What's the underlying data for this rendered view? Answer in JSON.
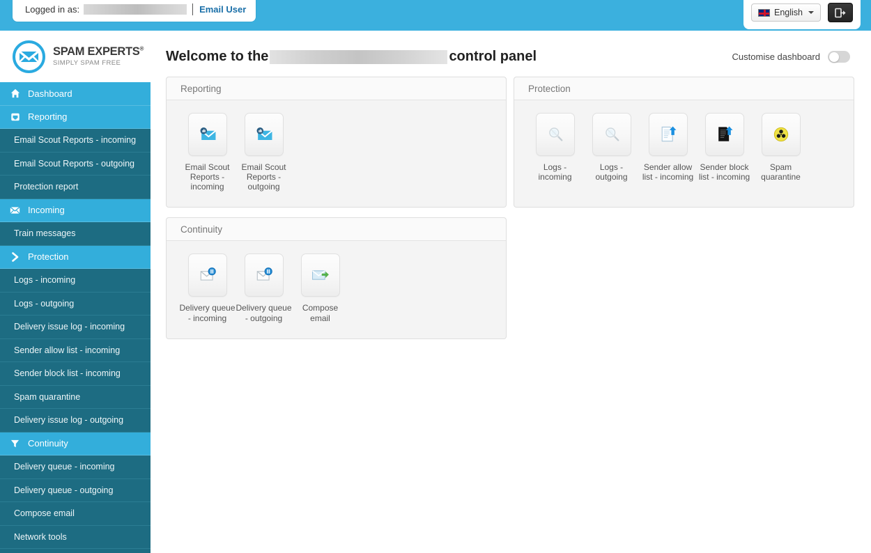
{
  "topbar": {
    "logged_in_label": "Logged in as:",
    "logged_in_user_redacted": "",
    "email_user_link": "Email User",
    "language": "English",
    "language_flag_icon": "uk-flag-icon",
    "logout_icon": "logout-icon"
  },
  "brand": {
    "name_main": "SPAM EXPERTS",
    "registered_mark": "®",
    "tagline": "SIMPLY SPAM FREE",
    "logo_icon": "envelope-circle-logo-icon",
    "accent_color": "#3bb0de"
  },
  "sidebar": {
    "bg_color": "#1d6c82",
    "header_color": "#33aedb",
    "items": [
      {
        "label": "Dashboard",
        "type": "head",
        "icon": "home-icon"
      },
      {
        "label": "Reporting",
        "type": "head",
        "icon": "inbox-tray-icon"
      },
      {
        "label": "Email Scout Reports - incoming",
        "type": "sub"
      },
      {
        "label": "Email Scout Reports - outgoing",
        "type": "sub"
      },
      {
        "label": "Protection report",
        "type": "sub"
      },
      {
        "label": "Incoming",
        "type": "head",
        "icon": "envelope-icon"
      },
      {
        "label": "Train messages",
        "type": "sub"
      },
      {
        "label": "Protection",
        "type": "head",
        "icon": "chevron-right-icon"
      },
      {
        "label": "Logs - incoming",
        "type": "sub"
      },
      {
        "label": "Logs - outgoing",
        "type": "sub"
      },
      {
        "label": "Delivery issue log - incoming",
        "type": "sub"
      },
      {
        "label": "Sender allow list - incoming",
        "type": "sub"
      },
      {
        "label": "Sender block list - incoming",
        "type": "sub"
      },
      {
        "label": "Spam quarantine",
        "type": "sub"
      },
      {
        "label": "Delivery issue log - outgoing",
        "type": "sub"
      },
      {
        "label": "Continuity",
        "type": "head",
        "icon": "funnel-icon"
      },
      {
        "label": "Delivery queue - incoming",
        "type": "sub"
      },
      {
        "label": "Delivery queue - outgoing",
        "type": "sub"
      },
      {
        "label": "Compose email",
        "type": "sub"
      },
      {
        "label": "Network tools",
        "type": "sub"
      }
    ]
  },
  "main": {
    "title_prefix": "Welcome to the",
    "title_redacted_domain": "",
    "title_suffix": "control panel",
    "customise_label": "Customise dashboard",
    "customise_toggle_state": "off",
    "panels": [
      {
        "title": "Reporting",
        "tiles": [
          {
            "label": "Email Scout Reports - incoming",
            "icon": "envelope-chart-icon"
          },
          {
            "label": "Email Scout Reports - outgoing",
            "icon": "envelope-chart-icon"
          }
        ]
      },
      {
        "title": "Protection",
        "tiles": [
          {
            "label": "Logs - incoming",
            "icon": "magnifier-icon"
          },
          {
            "label": "Logs - outgoing",
            "icon": "magnifier-icon"
          },
          {
            "label": "Sender allow list - incoming",
            "icon": "document-allow-arrow-icon"
          },
          {
            "label": "Sender block list - incoming",
            "icon": "document-block-arrow-icon"
          },
          {
            "label": "Spam quarantine",
            "icon": "biohazard-icon"
          }
        ]
      },
      {
        "title": "Continuity",
        "tiles": [
          {
            "label": "Delivery queue - incoming",
            "icon": "envelope-pause-icon"
          },
          {
            "label": "Delivery queue - outgoing",
            "icon": "envelope-pause-icon"
          },
          {
            "label": "Compose email",
            "icon": "compose-email-icon"
          }
        ]
      }
    ]
  }
}
